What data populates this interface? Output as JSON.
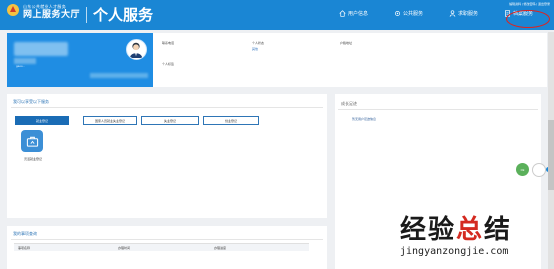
{
  "header": {
    "org_small": "山东公共就业人才服务",
    "org_big": "网上服务大厅",
    "page_title": "个人服务",
    "top_links": "编辑资料 | 修改密码 | 退出登录",
    "nav": [
      {
        "label": "用户信息",
        "icon": "home-icon"
      },
      {
        "label": "公共服务",
        "icon": "gear-icon"
      },
      {
        "label": "求职服务",
        "icon": "person-icon"
      },
      {
        "label": "档案服务",
        "icon": "file-icon"
      }
    ],
    "accent": "#1a86d4",
    "annotation_color": "#e0221d"
  },
  "profile": {
    "blur_caption": "gaoo...",
    "fields": {
      "contact_label": "联系电话",
      "person_status_label": "个人状态",
      "person_status_value": "其他",
      "hukou_label": "户籍地址",
      "tags_label": "个人标签"
    }
  },
  "services_panel": {
    "title": "我可以享受以下服务",
    "tabs": [
      "就业登记",
      "国家人员就业失业登记",
      "失业登记",
      "创业登记"
    ],
    "active_tab": 0,
    "service_item": {
      "label": "灵活就业登记",
      "icon": "briefcase-icon"
    }
  },
  "progress_panel": {
    "title": "我的事项查询",
    "columns": [
      "事项名称",
      "办理时间",
      "办理进度"
    ]
  },
  "side_panel": {
    "title": "成长足迹",
    "message": "暂无用户足迹信息"
  },
  "float": {
    "badge": "Ok"
  },
  "watermark": {
    "cn_black_1": "经验",
    "cn_red": "总",
    "cn_black_2": "结",
    "en": "jingyanzongjie.com"
  }
}
